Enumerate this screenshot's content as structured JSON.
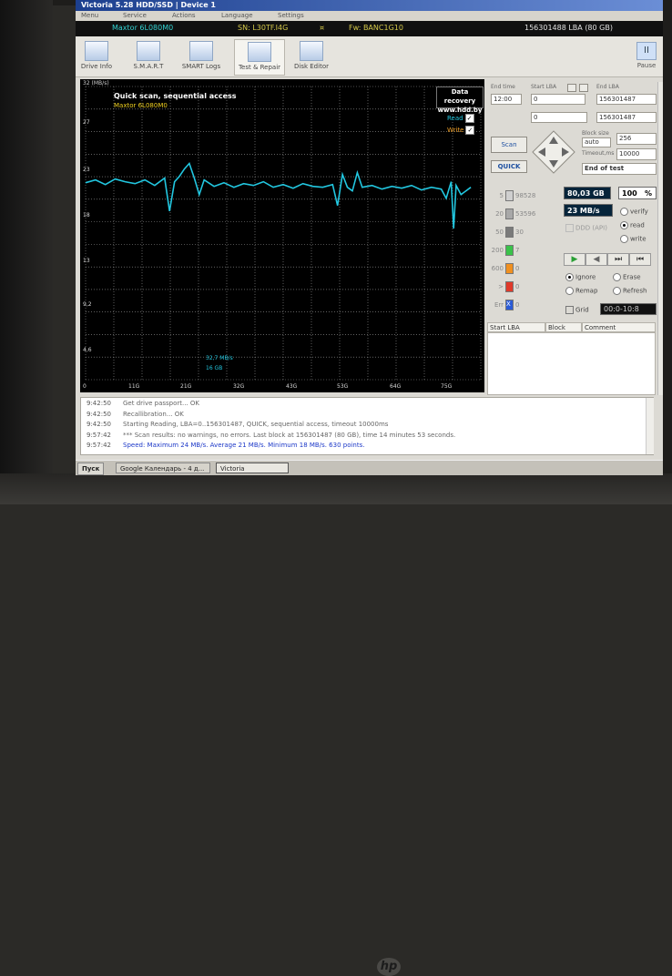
{
  "window": {
    "title": "Victoria 5.28 HDD/SSD | Device 1"
  },
  "menu": [
    "Menu",
    "Service",
    "Actions",
    "Language",
    "Settings"
  ],
  "drive_info": {
    "model": "Maxtor 6L080M0",
    "serial": "SN: L30TF.I4G",
    "fw": "Fw: BANC1G10",
    "lba_total": "156301488 LBA (80 GB)",
    "symbol": "¤"
  },
  "toolbar": {
    "buttons": [
      "Drive Info",
      "S.M.A.R.T",
      "SMART Logs",
      "Test & Repair",
      "Disk Editor"
    ],
    "pause": "Pause",
    "pause_glyph": "II"
  },
  "graph": {
    "title": "Quick scan, sequential access",
    "model": "Maxtor 6L080M0",
    "ad": [
      "Data recovery",
      "www.hdd.by"
    ],
    "unit": "32 (MB/s)",
    "y_ticks": [
      "27",
      "23",
      "18",
      "13",
      "9,2",
      "4,6",
      "0"
    ],
    "x_ticks": [
      "11G",
      "21G",
      "32G",
      "43G",
      "53G",
      "64G",
      "75G"
    ],
    "read_label": "Read",
    "write_label": "Write",
    "check": "✓",
    "current_speed": "32,7 MB/s",
    "current_pos": "16 GB"
  },
  "chart_data": {
    "type": "line",
    "title": "Quick scan, sequential access",
    "xlabel": "",
    "ylabel": "32 (MB/s)",
    "ylim": [
      0,
      32
    ],
    "xlim": [
      0,
      80
    ],
    "x_tick_labels": [
      "11G",
      "21G",
      "32G",
      "43G",
      "53G",
      "64G",
      "75G"
    ],
    "y_tick_labels": [
      "27",
      "23",
      "18",
      "13",
      "9,2",
      "4,6",
      "0"
    ],
    "grid": true,
    "legend": "top-right",
    "series": [
      {
        "name": "Read",
        "color": "#22c7e0",
        "x": [
          0,
          2,
          4,
          6,
          8,
          10,
          12,
          14,
          16,
          17,
          18,
          19,
          20,
          21,
          22,
          23,
          24,
          26,
          28,
          30,
          32,
          34,
          36,
          38,
          40,
          42,
          44,
          46,
          48,
          50,
          51,
          52,
          53,
          54,
          55,
          56,
          58,
          60,
          62,
          64,
          66,
          68,
          70,
          72,
          73,
          74,
          74.5,
          75,
          76,
          78
        ],
        "y": [
          21.5,
          21.8,
          21.3,
          21.9,
          21.6,
          21.4,
          21.8,
          21.2,
          22.0,
          18.4,
          21.6,
          22.2,
          23.0,
          23.6,
          22.0,
          20.2,
          21.8,
          21.1,
          21.5,
          21.0,
          21.4,
          21.2,
          21.6,
          21.0,
          21.3,
          20.9,
          21.4,
          21.1,
          21.0,
          21.3,
          19.0,
          22.4,
          21.0,
          20.6,
          22.6,
          21.0,
          21.2,
          20.8,
          21.1,
          20.9,
          21.2,
          20.7,
          21.0,
          20.8,
          19.8,
          21.6,
          16.5,
          21.2,
          20.2,
          21.0
        ]
      }
    ]
  },
  "panel": {
    "start_lba_label": "Start LBA",
    "end_lba_label": "End LBA",
    "end_time_label": "End time",
    "time_value": "12:00",
    "start_lba_value": "0",
    "end_lba_value": "156301487",
    "start_lba_value2": "0",
    "end_lba_value2": "156301487",
    "small_btn": " ",
    "max_label": "MAX",
    "scan_btn": "Scan",
    "quick_btn": "QUICK",
    "block_size_label": "Block size",
    "block_size_auto": "auto",
    "block_size_value": "256",
    "timeout_label": "Timeout,ms",
    "timeout_value": "10000",
    "end_action": "End of test",
    "progress_gb": "80,03 GB",
    "progress_pct": "100",
    "pct_sign": "%",
    "speed": "23 MB/s",
    "ddd_label": "DDD (API)",
    "verify": "verify",
    "read": "read",
    "write": "write",
    "counters": [
      {
        "ms": "5",
        "count": "98528",
        "color": "#cfcfcf"
      },
      {
        "ms": "20",
        "count": "53596",
        "color": "#a8a8a8"
      },
      {
        "ms": "50",
        "count": "30",
        "color": "#7a7a7a"
      },
      {
        "ms": "200",
        "count": "7",
        "color": "#3ac24a"
      },
      {
        "ms": "600",
        "count": "0",
        "color": "#f09020"
      },
      {
        "ms": ">",
        "count": "0",
        "color": "#e03a2a"
      },
      {
        "ms": "Err",
        "count": "0",
        "color": "#2a5bd7"
      }
    ],
    "err_mark": "X",
    "ignore": "Ignore",
    "erase": "Erase",
    "remap": "Remap",
    "refresh": "Refresh",
    "grid_label": "Grid",
    "grid_time": "00:0-10:8",
    "table_cols": [
      "Start LBA",
      "Block",
      "Comment"
    ],
    "player": [
      "▶",
      "◀",
      "⏭",
      "⏮"
    ]
  },
  "log": [
    {
      "time": "9:42:50",
      "msg": "Get drive passport... OK",
      "blue": false
    },
    {
      "time": "9:42:50",
      "msg": "Recallibration... OK",
      "blue": false
    },
    {
      "time": "9:42:50",
      "msg": "Starting Reading, LBA=0..156301487, QUICK, sequential access, timeout 10000ms",
      "blue": false
    },
    {
      "time": "9:57:42",
      "msg": "*** Scan results: no warnings, no errors. Last block at 156301487 (80 GB), time 14 minutes 53 seconds.",
      "blue": false
    },
    {
      "time": "9:57:42",
      "msg": "Speed: Maximum 24 MB/s. Average 21 MB/s. Minimum 18 MB/s. 630 points.",
      "blue": true
    }
  ],
  "taskbar": {
    "start": "Пуск",
    "tasks": [
      "Google Календарь - 4 д...",
      "Victoria"
    ]
  },
  "monitor": {
    "brand": "hp"
  }
}
